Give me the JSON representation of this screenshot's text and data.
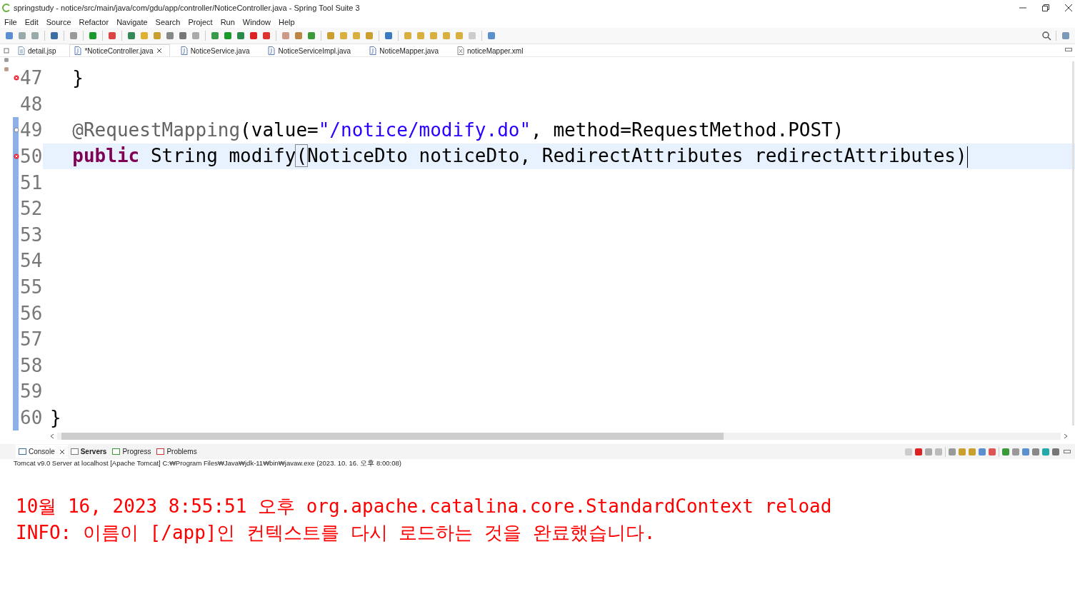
{
  "window": {
    "title": "springstudy - notice/src/main/java/com/gdu/app/controller/NoticeController.java - Spring Tool Suite 3"
  },
  "menu": [
    "File",
    "Edit",
    "Source",
    "Refactor",
    "Navigate",
    "Search",
    "Project",
    "Run",
    "Window",
    "Help"
  ],
  "editor_tabs": [
    {
      "label": "detail.jsp",
      "kind": "jsp",
      "selected": false
    },
    {
      "label": "*NoticeController.java",
      "kind": "java",
      "selected": true
    },
    {
      "label": "NoticeService.java",
      "kind": "java",
      "selected": false
    },
    {
      "label": "NoticeServiceImpl.java",
      "kind": "java",
      "selected": false
    },
    {
      "label": "NoticeMapper.java",
      "kind": "java",
      "selected": false
    },
    {
      "label": "noticeMapper.xml",
      "kind": "xml",
      "selected": false
    }
  ],
  "code_lines": [
    {
      "number": "47",
      "error": true,
      "override": false,
      "changed": false,
      "current": false,
      "tokens": [
        {
          "kind": "plain",
          "text": "  }"
        }
      ]
    },
    {
      "number": "48",
      "error": false,
      "override": false,
      "changed": false,
      "current": false
    },
    {
      "number": "49",
      "error": false,
      "override": true,
      "changed": true,
      "current": false,
      "tokens": [
        {
          "kind": "annotation",
          "text": "  @RequestMapping"
        },
        {
          "kind": "plain",
          "text": "(value="
        },
        {
          "kind": "string",
          "text": "\"/notice/modify.do\""
        },
        {
          "kind": "plain",
          "text": ", method=RequestMethod.POST)"
        }
      ]
    },
    {
      "number": "50",
      "error": true,
      "override": false,
      "changed": true,
      "current": true,
      "tokens": [
        {
          "kind": "keyword",
          "text": "  public"
        },
        {
          "kind": "plain",
          "text": " String modify"
        },
        {
          "kind": "bracket",
          "text": "("
        },
        {
          "kind": "plain",
          "text": "NoticeDto noticeDto, RedirectAttributes redirectAttributes)"
        }
      ]
    },
    {
      "number": "51",
      "error": false,
      "override": false,
      "changed": true,
      "current": false
    },
    {
      "number": "52",
      "error": false,
      "override": false,
      "changed": true,
      "current": false
    },
    {
      "number": "53",
      "error": false,
      "override": false,
      "changed": true,
      "current": false
    },
    {
      "number": "54",
      "error": false,
      "override": false,
      "changed": true,
      "current": false
    },
    {
      "number": "55",
      "error": false,
      "override": false,
      "changed": true,
      "current": false
    },
    {
      "number": "56",
      "error": false,
      "override": false,
      "changed": true,
      "current": false
    },
    {
      "number": "57",
      "error": false,
      "override": false,
      "changed": true,
      "current": false
    },
    {
      "number": "58",
      "error": false,
      "override": false,
      "changed": true,
      "current": false
    },
    {
      "number": "59",
      "error": false,
      "override": false,
      "changed": true,
      "current": false
    },
    {
      "number": "60",
      "error": false,
      "override": false,
      "changed": true,
      "current": false,
      "tokens": [
        {
          "kind": "plain",
          "text": "}"
        }
      ]
    }
  ],
  "console_tabs": [
    {
      "label": "Console",
      "selected": true,
      "updated": false
    },
    {
      "label": "Servers",
      "selected": false,
      "updated": true
    },
    {
      "label": "Progress",
      "selected": false,
      "updated": false
    },
    {
      "label": "Problems",
      "selected": false,
      "updated": false
    }
  ],
  "console_info": "Tomcat v9.0 Server at localhost [Apache Tomcat] C:₩Program Files₩Java₩jdk-11₩bin₩javaw.exe  (2023. 10. 16. 오후 8:00:08)",
  "console_output": [
    "10월 16, 2023 8:55:51 오후 org.apache.catalina.core.StandardContext reload",
    "INFO: 이름이 [/app]인 컨텍스트를 다시 로드하는 것을 완료했습니다."
  ]
}
